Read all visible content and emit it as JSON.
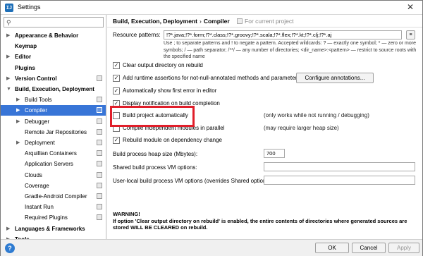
{
  "window": {
    "title": "Settings",
    "close_glyph": "✕"
  },
  "sidebar": {
    "items": [
      {
        "label": "Appearance & Behavior",
        "bold": true,
        "arrow": "▶"
      },
      {
        "label": "Keymap",
        "bold": true,
        "arrow": ""
      },
      {
        "label": "Editor",
        "bold": true,
        "arrow": "▶"
      },
      {
        "label": "Plugins",
        "bold": true,
        "arrow": ""
      },
      {
        "label": "Version Control",
        "bold": true,
        "arrow": "▶"
      },
      {
        "label": "Build, Execution, Deployment",
        "bold": true,
        "arrow": "▼"
      },
      {
        "label": "Build Tools",
        "bold": false,
        "arrow": "▶"
      },
      {
        "label": "Compiler",
        "bold": false,
        "arrow": "▶"
      },
      {
        "label": "Debugger",
        "bold": false,
        "arrow": "▶"
      },
      {
        "label": "Remote Jar Repositories",
        "bold": false,
        "arrow": ""
      },
      {
        "label": "Deployment",
        "bold": false,
        "arrow": "▶"
      },
      {
        "label": "Arquillian Containers",
        "bold": false,
        "arrow": ""
      },
      {
        "label": "Application Servers",
        "bold": false,
        "arrow": ""
      },
      {
        "label": "Clouds",
        "bold": false,
        "arrow": ""
      },
      {
        "label": "Coverage",
        "bold": false,
        "arrow": ""
      },
      {
        "label": "Gradle-Android Compiler",
        "bold": false,
        "arrow": ""
      },
      {
        "label": "Instant Run",
        "bold": false,
        "arrow": ""
      },
      {
        "label": "Required Plugins",
        "bold": false,
        "arrow": ""
      },
      {
        "label": "Languages & Frameworks",
        "bold": true,
        "arrow": "▶"
      },
      {
        "label": "Tools",
        "bold": true,
        "arrow": "▶"
      }
    ]
  },
  "breadcrumb": {
    "parent": "Build, Execution, Deployment",
    "separator": "›",
    "current": "Compiler",
    "scope": "For current project"
  },
  "compiler": {
    "resource_patterns_label": "Resource patterns:",
    "resource_patterns_value": "!?*.java;!?*.form;!?*.class;!?*.groovy;!?*.scala;!?*.flex;!?*.kt;!?*.clj;!?*.aj",
    "resource_hint": "Use ; to separate patterns and ! to negate a pattern. Accepted wildcards: ? — exactly one symbol; * — zero or more symbols; / — path separator; /**/ — any number of directories; <dir_name>:<pattern> — restrict to source roots with the specified name",
    "checkboxes": [
      {
        "label": "Clear output directory on rebuild",
        "checked": true
      },
      {
        "label": "Add runtime assertions for not-null-annotated methods and parameters",
        "checked": true
      },
      {
        "label": "Automatically show first error in editor",
        "checked": true
      },
      {
        "label": "Display notification on build completion",
        "checked": true
      },
      {
        "label": "Build project automatically",
        "checked": false
      },
      {
        "label": "Compile independent modules in parallel",
        "checked": false
      },
      {
        "label": "Rebuild module on dependency change",
        "checked": true
      }
    ],
    "configure_annotations_button": "Configure annotations...",
    "build_auto_note": "(only works while not running / debugging)",
    "parallel_note": "(may require larger heap size)",
    "heap_label": "Build process heap size (Mbytes):",
    "heap_value": "700",
    "shared_vm_label": "Shared build process VM options:",
    "shared_vm_value": "",
    "user_vm_label": "User-local build process VM options (overrides Shared options):",
    "user_vm_value": "",
    "warning_title": "WARNING!",
    "warning_text": "If option 'Clear output directory on rebuild' is enabled, the entire contents of directories where generated sources are stored WILL BE CLEARED on rebuild."
  },
  "buttons": {
    "help": "?",
    "ok": "OK",
    "cancel": "Cancel",
    "apply": "Apply"
  },
  "colors": {
    "selection": "#3875d7",
    "highlight": "#e01e2a",
    "help": "#2e7bd1"
  }
}
